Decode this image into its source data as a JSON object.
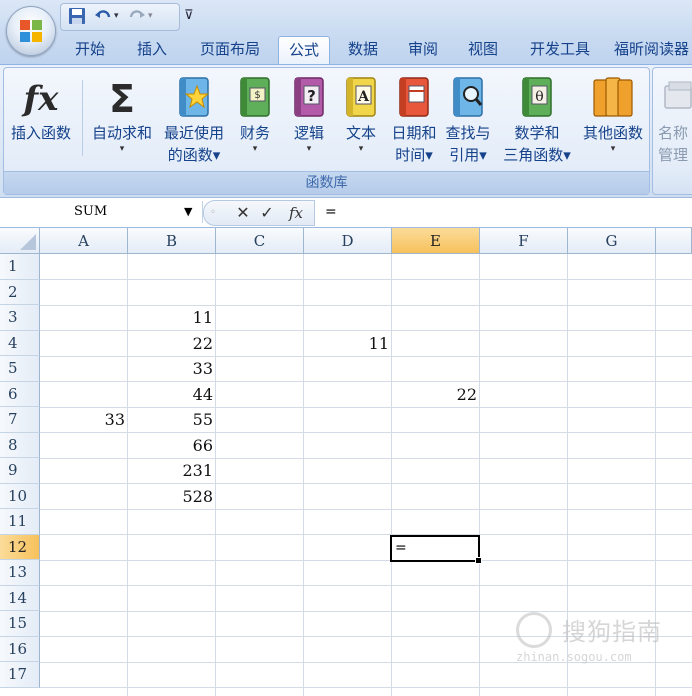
{
  "quick_access": {
    "save_icon": "save-icon",
    "undo_icon": "undo-icon",
    "redo_icon": "redo-icon",
    "customize_icon": "customize-qat-icon"
  },
  "tabs": [
    "开始",
    "插入",
    "页面布局",
    "公式",
    "数据",
    "审阅",
    "视图",
    "开发工具",
    "福昕阅读器"
  ],
  "active_tab": "公式",
  "ribbon": {
    "group_label": "函数库",
    "buttons": [
      {
        "line1": "插入函数",
        "line2": "",
        "icon": "fx-icon"
      },
      {
        "line1": "自动求和",
        "line2": "▾",
        "icon": "sigma-icon"
      },
      {
        "line1": "最近使用",
        "line2": "的函数▾",
        "icon": "star-book-icon"
      },
      {
        "line1": "财务",
        "line2": "▾",
        "icon": "finance-book-icon"
      },
      {
        "line1": "逻辑",
        "line2": "▾",
        "icon": "logic-book-icon"
      },
      {
        "line1": "文本",
        "line2": "▾",
        "icon": "text-book-icon"
      },
      {
        "line1": "日期和",
        "line2": "时间▾",
        "icon": "datetime-book-icon"
      },
      {
        "line1": "查找与",
        "line2": "引用▾",
        "icon": "lookup-book-icon"
      },
      {
        "line1": "数学和",
        "line2": "三角函数▾",
        "icon": "math-book-icon"
      },
      {
        "line1": "其他函数",
        "line2": "▾",
        "icon": "more-books-icon"
      }
    ],
    "names_group": {
      "line1": "名称",
      "line2": "管理"
    }
  },
  "formula_bar": {
    "name_box": "SUM",
    "cancel_symbol": "✕",
    "enter_symbol": "✓",
    "fx_symbol": "fx",
    "content": "="
  },
  "sheet": {
    "columns": [
      "A",
      "B",
      "C",
      "D",
      "E",
      "F",
      "G"
    ],
    "selected_column": "E",
    "rows": [
      "1",
      "2",
      "3",
      "4",
      "5",
      "6",
      "7",
      "8",
      "9",
      "10",
      "11",
      "12",
      "13",
      "14",
      "15",
      "16",
      "17"
    ],
    "selected_row": "12",
    "cells": {
      "B3": "11",
      "B4": "22",
      "B5": "33",
      "B6": "44",
      "B7": "55",
      "B8": "66",
      "B9": "231",
      "B10": "528",
      "D4": "11",
      "E6": "22",
      "A7": "33",
      "E12": "="
    }
  },
  "watermark": {
    "main": "搜狗指南",
    "sub": "zhinan.sogou.com"
  }
}
